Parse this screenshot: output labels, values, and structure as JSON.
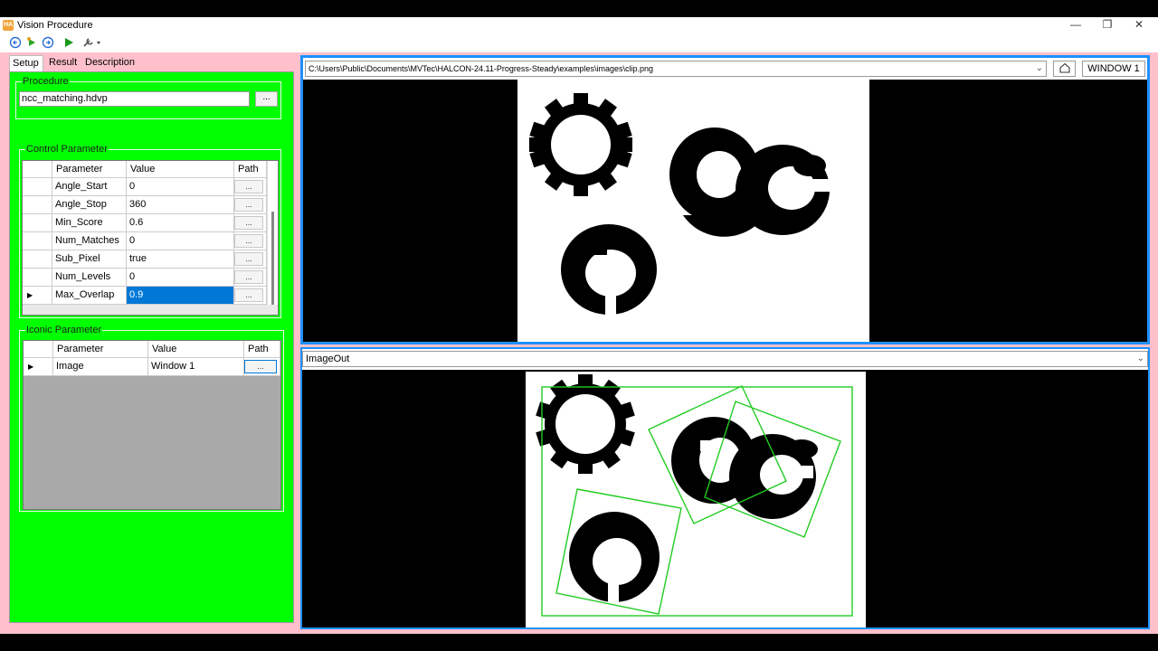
{
  "window": {
    "app_icon": "HA",
    "title": "Vision Procedure",
    "minimize": "—",
    "maximize": "❐",
    "close": "✕"
  },
  "toolbar": {
    "icons": [
      "back-circle-icon",
      "run-step-icon",
      "forward-circle-icon",
      "play-icon",
      "tools-dropdown-icon"
    ]
  },
  "tabs": {
    "setup": "Setup",
    "result": "Result",
    "description": "Description"
  },
  "procedure": {
    "group_title": "Procedure",
    "file": "ncc_matching.hdvp",
    "browse_label": "..."
  },
  "control_parameter": {
    "group_title": "Control Parameter",
    "headers": [
      "Parameter",
      "Value",
      "Path"
    ],
    "rows": [
      {
        "name": "Angle_Start",
        "value": "0",
        "path": "..."
      },
      {
        "name": "Angle_Stop",
        "value": "360",
        "path": "..."
      },
      {
        "name": "Min_Score",
        "value": "0.6",
        "path": "..."
      },
      {
        "name": "Num_Matches",
        "value": "0",
        "path": "..."
      },
      {
        "name": "Sub_Pixel",
        "value": "true",
        "path": "..."
      },
      {
        "name": "Num_Levels",
        "value": "0",
        "path": "..."
      },
      {
        "name": "Max_Overlap",
        "value": "0.9",
        "path": "..."
      }
    ],
    "current_row_marker": "▶"
  },
  "iconic_parameter": {
    "group_title": "Iconic Parameter",
    "headers": [
      "Parameter",
      "Value",
      "Path"
    ],
    "rows": [
      {
        "name": "Image",
        "value": "Window 1",
        "path": "..."
      }
    ],
    "current_row_marker": "▶"
  },
  "top_viewer": {
    "path": "C:\\Users\\Public\\Documents\\MVTec\\HALCON-24.11-Progress-Steady\\examples\\images\\clip.png",
    "home_icon": "home-icon",
    "window_label": "WINDOW 1"
  },
  "bottom_viewer": {
    "selection": "ImageOut"
  },
  "colors": {
    "panel_green": "#00ff00",
    "viewer_border": "#1e90ff",
    "background_pink": "#ffc0cb",
    "match_green": "#22cc22",
    "selection_blue": "#0078d7"
  }
}
